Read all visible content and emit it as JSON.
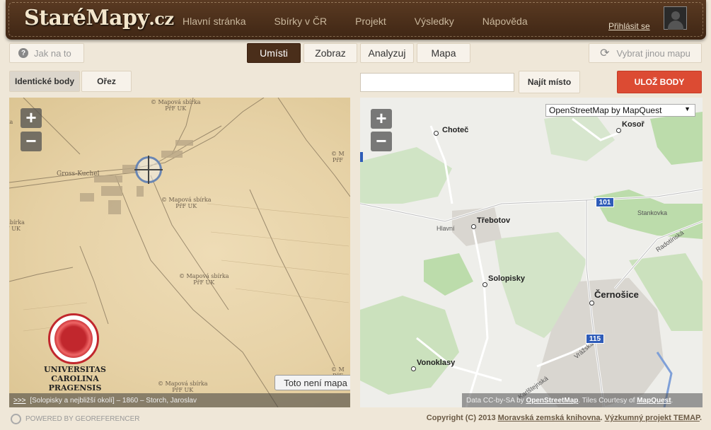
{
  "header": {
    "logo": "StaréMapy",
    "logo_suffix": ".cz",
    "nav": [
      "Hlavní stránka",
      "Sbírky v ČR",
      "Projekt",
      "Výsledky",
      "Nápověda"
    ],
    "login": "Přihlásit se"
  },
  "toolbar": {
    "help": "Jak na to",
    "tabs": [
      "Umísti",
      "Zobraz",
      "Analyzuj",
      "Mapa"
    ],
    "active_tab": "Umísti",
    "reload": "Vybrat jinou mapu"
  },
  "controls": {
    "segment_1": "Identické body",
    "segment_2": "Ořez",
    "search_placeholder": "",
    "find": "Najít místo",
    "save": "ULOŽ BODY"
  },
  "old_map": {
    "stamp_text": "© Mapová sbírka\nPřF UK",
    "town_label": "Gross-Kuchel",
    "uni_line1": "UNIVERSITAS CAROLINA",
    "uni_line2": "PRAGENSIS",
    "not_map_button": "Toto není mapa",
    "attribution_link": ">>>",
    "attribution": "[Solopisky a nejbližší okolí] – 1860 – Storch, Jaroslav"
  },
  "new_map": {
    "layer": "OpenStreetMap by MapQuest",
    "places": [
      "Choteč",
      "Kosoř",
      "Třebotov",
      "Solopisky",
      "Černošice",
      "Vonoklasy"
    ],
    "road_labels": [
      "Hlavní",
      "Radotínská",
      "Vrážská",
      "Karlštejnská",
      "Stankovka"
    ],
    "shields": [
      "101",
      "115"
    ],
    "attribution_prefix": "Data CC-by-SA by ",
    "attribution_osm": "OpenStreetMap",
    "attribution_mid": ". Tiles Courtesy of ",
    "attribution_mq": "MapQuest",
    "attribution_end": "."
  },
  "footer": {
    "powered": "POWERED BY GEOREFERENCER",
    "copyright_prefix": "Copyright (C) 2013 ",
    "library": "Moravská zemská knihovna",
    "sep": ". ",
    "project": "Výzkumný projekt TEMAP",
    "end": "."
  },
  "colors": {
    "header_brown": "#4a2e1a",
    "save_red": "#dc4b33",
    "shield_blue": "#2f5cb8",
    "forest_green": "#b3d9a0"
  }
}
